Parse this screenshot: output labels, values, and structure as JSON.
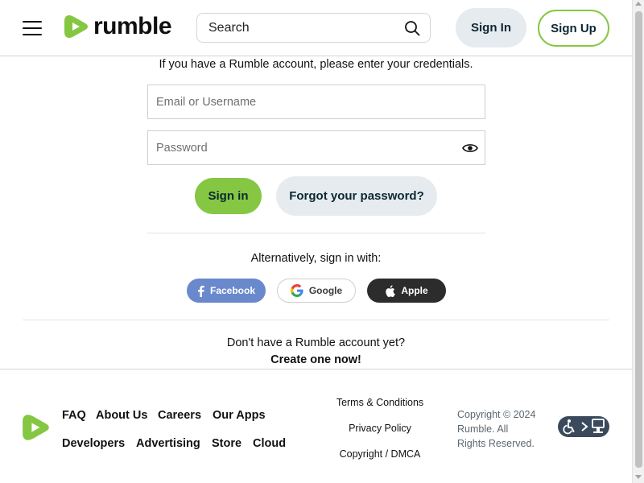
{
  "header": {
    "logo_text": "rumble",
    "search_placeholder": "Search",
    "signin_label": "Sign In",
    "signup_label": "Sign Up"
  },
  "login": {
    "intro": "If you have a Rumble account, please enter your credentials.",
    "username_placeholder": "Email or Username",
    "password_placeholder": "Password",
    "signin_button": "Sign in",
    "forgot_button": "Forgot your password?",
    "alternative_text": "Alternatively, sign in with:",
    "social": [
      {
        "label": "Facebook",
        "icon": "facebook-icon"
      },
      {
        "label": "Google",
        "icon": "google-icon"
      },
      {
        "label": "Apple",
        "icon": "apple-icon"
      }
    ],
    "no_account_text": "Don't have a Rumble account yet?",
    "create_link": "Create one now!"
  },
  "footer": {
    "nav": [
      "FAQ",
      "About Us",
      "Careers",
      "Our Apps",
      "Developers",
      "Advertising",
      "Store",
      "Cloud"
    ],
    "legal": [
      "Terms & Conditions",
      "Privacy Policy",
      "Copyright / DMCA"
    ],
    "copyright": "Copyright © 2024 Rumble. All Rights Reserved."
  },
  "colors": {
    "brand_green": "#85c742",
    "button_gray": "#e6ebef",
    "facebook_blue": "#6a89cc",
    "apple_dark": "#2c2c2c",
    "text_dark_teal": "#0b2833"
  }
}
